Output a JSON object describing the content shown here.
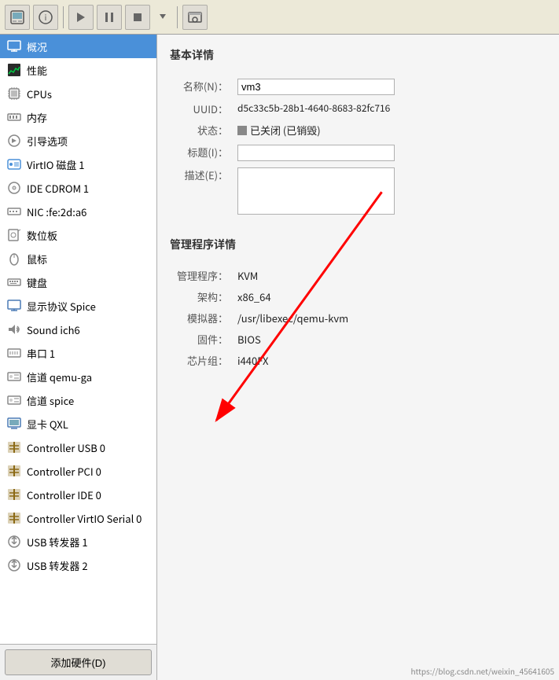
{
  "toolbar": {
    "buttons": [
      {
        "name": "overview-icon-btn",
        "icon": "🖥",
        "label": "概况视图"
      },
      {
        "name": "details-icon-btn",
        "icon": "📋",
        "label": "详情视图"
      },
      {
        "name": "play-btn",
        "icon": "▶",
        "label": "运行"
      },
      {
        "name": "pause-btn",
        "icon": "⏸",
        "label": "暂停"
      },
      {
        "name": "stop-btn",
        "icon": "⏹",
        "label": "停止"
      },
      {
        "name": "dropdown-btn",
        "icon": "▾",
        "label": "更多"
      },
      {
        "name": "snapshot-btn",
        "icon": "📷",
        "label": "快照"
      }
    ]
  },
  "sidebar": {
    "items": [
      {
        "id": "overview",
        "label": "概况",
        "icon": "🖥",
        "active": true
      },
      {
        "id": "performance",
        "label": "性能",
        "icon": "📊"
      },
      {
        "id": "cpus",
        "label": "CPUs",
        "icon": "🔲"
      },
      {
        "id": "memory",
        "label": "内存",
        "icon": "🔳"
      },
      {
        "id": "boot",
        "label": "引导选项",
        "icon": "⚙"
      },
      {
        "id": "virtio-disk",
        "label": "VirtIO 磁盘 1",
        "icon": "💾"
      },
      {
        "id": "ide-cdrom",
        "label": "IDE CDROM 1",
        "icon": "💿"
      },
      {
        "id": "nic",
        "label": "NIC :fe:2d:a6",
        "icon": "🌐"
      },
      {
        "id": "tablet",
        "label": "数位板",
        "icon": "✏"
      },
      {
        "id": "mouse",
        "label": "鼠标",
        "icon": "🖱"
      },
      {
        "id": "keyboard",
        "label": "键盘",
        "icon": "⌨"
      },
      {
        "id": "display-spice",
        "label": "显示协议 Spice",
        "icon": "🖥"
      },
      {
        "id": "sound-ich6",
        "label": "Sound ich6",
        "icon": "🔊"
      },
      {
        "id": "serial1",
        "label": "串口 1",
        "icon": "📟"
      },
      {
        "id": "channel-qemu-ga",
        "label": "信道 qemu-ga",
        "icon": "📡"
      },
      {
        "id": "channel-spice",
        "label": "信道 spice",
        "icon": "📡"
      },
      {
        "id": "video-qxl",
        "label": "显卡 QXL",
        "icon": "🖥"
      },
      {
        "id": "ctrl-usb0",
        "label": "Controller USB 0",
        "icon": "🔌"
      },
      {
        "id": "ctrl-pci0",
        "label": "Controller PCI 0",
        "icon": "🔌"
      },
      {
        "id": "ctrl-ide0",
        "label": "Controller IDE 0",
        "icon": "🔌"
      },
      {
        "id": "ctrl-virtio-serial0",
        "label": "Controller VirtIO Serial 0",
        "icon": "🔌"
      },
      {
        "id": "usb-redirect1",
        "label": "USB 转发器 1",
        "icon": "🔌"
      },
      {
        "id": "usb-redirect2",
        "label": "USB 转发器 2",
        "icon": "🔌"
      }
    ],
    "add_btn_label": "添加硬件(D)"
  },
  "right_panel": {
    "basic_section_title": "基本详情",
    "fields": {
      "name_label": "名称(N)：",
      "name_value": "vm3",
      "uuid_label": "UUID：",
      "uuid_value": "d5c33c5b-28b1-4640-8683-82fc716",
      "status_label": "状态：",
      "status_value": "已关闭 (已销毁)",
      "title_label": "标题(I)：",
      "title_value": "",
      "desc_label": "描述(E)：",
      "desc_value": ""
    },
    "mgmt_section_title": "管理程序详情",
    "mgmt_fields": {
      "hypervisor_label": "管理程序：",
      "hypervisor_value": "KVM",
      "arch_label": "架构：",
      "arch_value": "x86_64",
      "emulator_label": "模拟器：",
      "emulator_value": "/usr/libexec/qemu-kvm",
      "firmware_label": "固件：",
      "firmware_value": "BIOS",
      "chipset_label": "芯片组：",
      "chipset_value": "i440FX"
    }
  },
  "watermark": "https://blog.csdn.net/weixin_45641605"
}
